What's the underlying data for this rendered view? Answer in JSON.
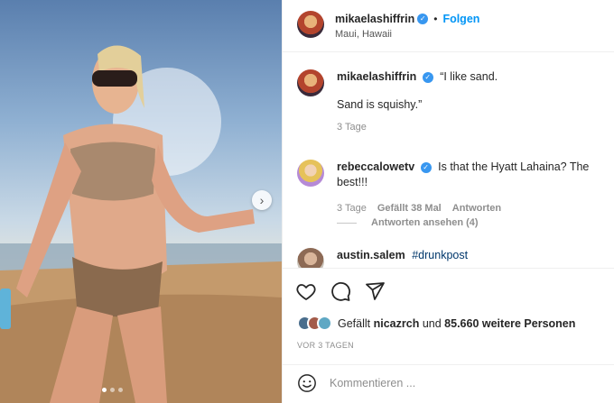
{
  "post": {
    "author": "mikaelashiffrin",
    "dot": "•",
    "follow_label": "Folgen",
    "location": "Maui, Hawaii"
  },
  "comments": [
    {
      "username": "mikaelashiffrin",
      "line1": "“I like sand.",
      "line2": "Sand is squishy.”",
      "time": "3 Tage"
    },
    {
      "username": "rebeccalowetv",
      "text": "Is that the Hyatt Lahaina? The best!!!",
      "time": "3 Tage",
      "likes": "Gefällt 38 Mal",
      "reply_label": "Antworten",
      "view_replies": "Antworten ansehen (4)"
    },
    {
      "username": "austin.salem",
      "text": "#drunkpost"
    }
  ],
  "likes": {
    "prefix": "Gefällt",
    "user": "nicazrch",
    "middle": "und",
    "others": "85.660 weitere Personen"
  },
  "date": "VOR 3 TAGEN",
  "comment_input": {
    "placeholder": "Kommentieren ..."
  },
  "icons": {
    "verified": "verified-badge-icon",
    "like": "heart-icon",
    "comment": "speech-bubble-icon",
    "share": "paper-plane-icon",
    "emoji": "smiley-icon",
    "next": "chevron-right-icon"
  },
  "colors": {
    "accent": "#0095f6",
    "verified": "#3897f0"
  }
}
